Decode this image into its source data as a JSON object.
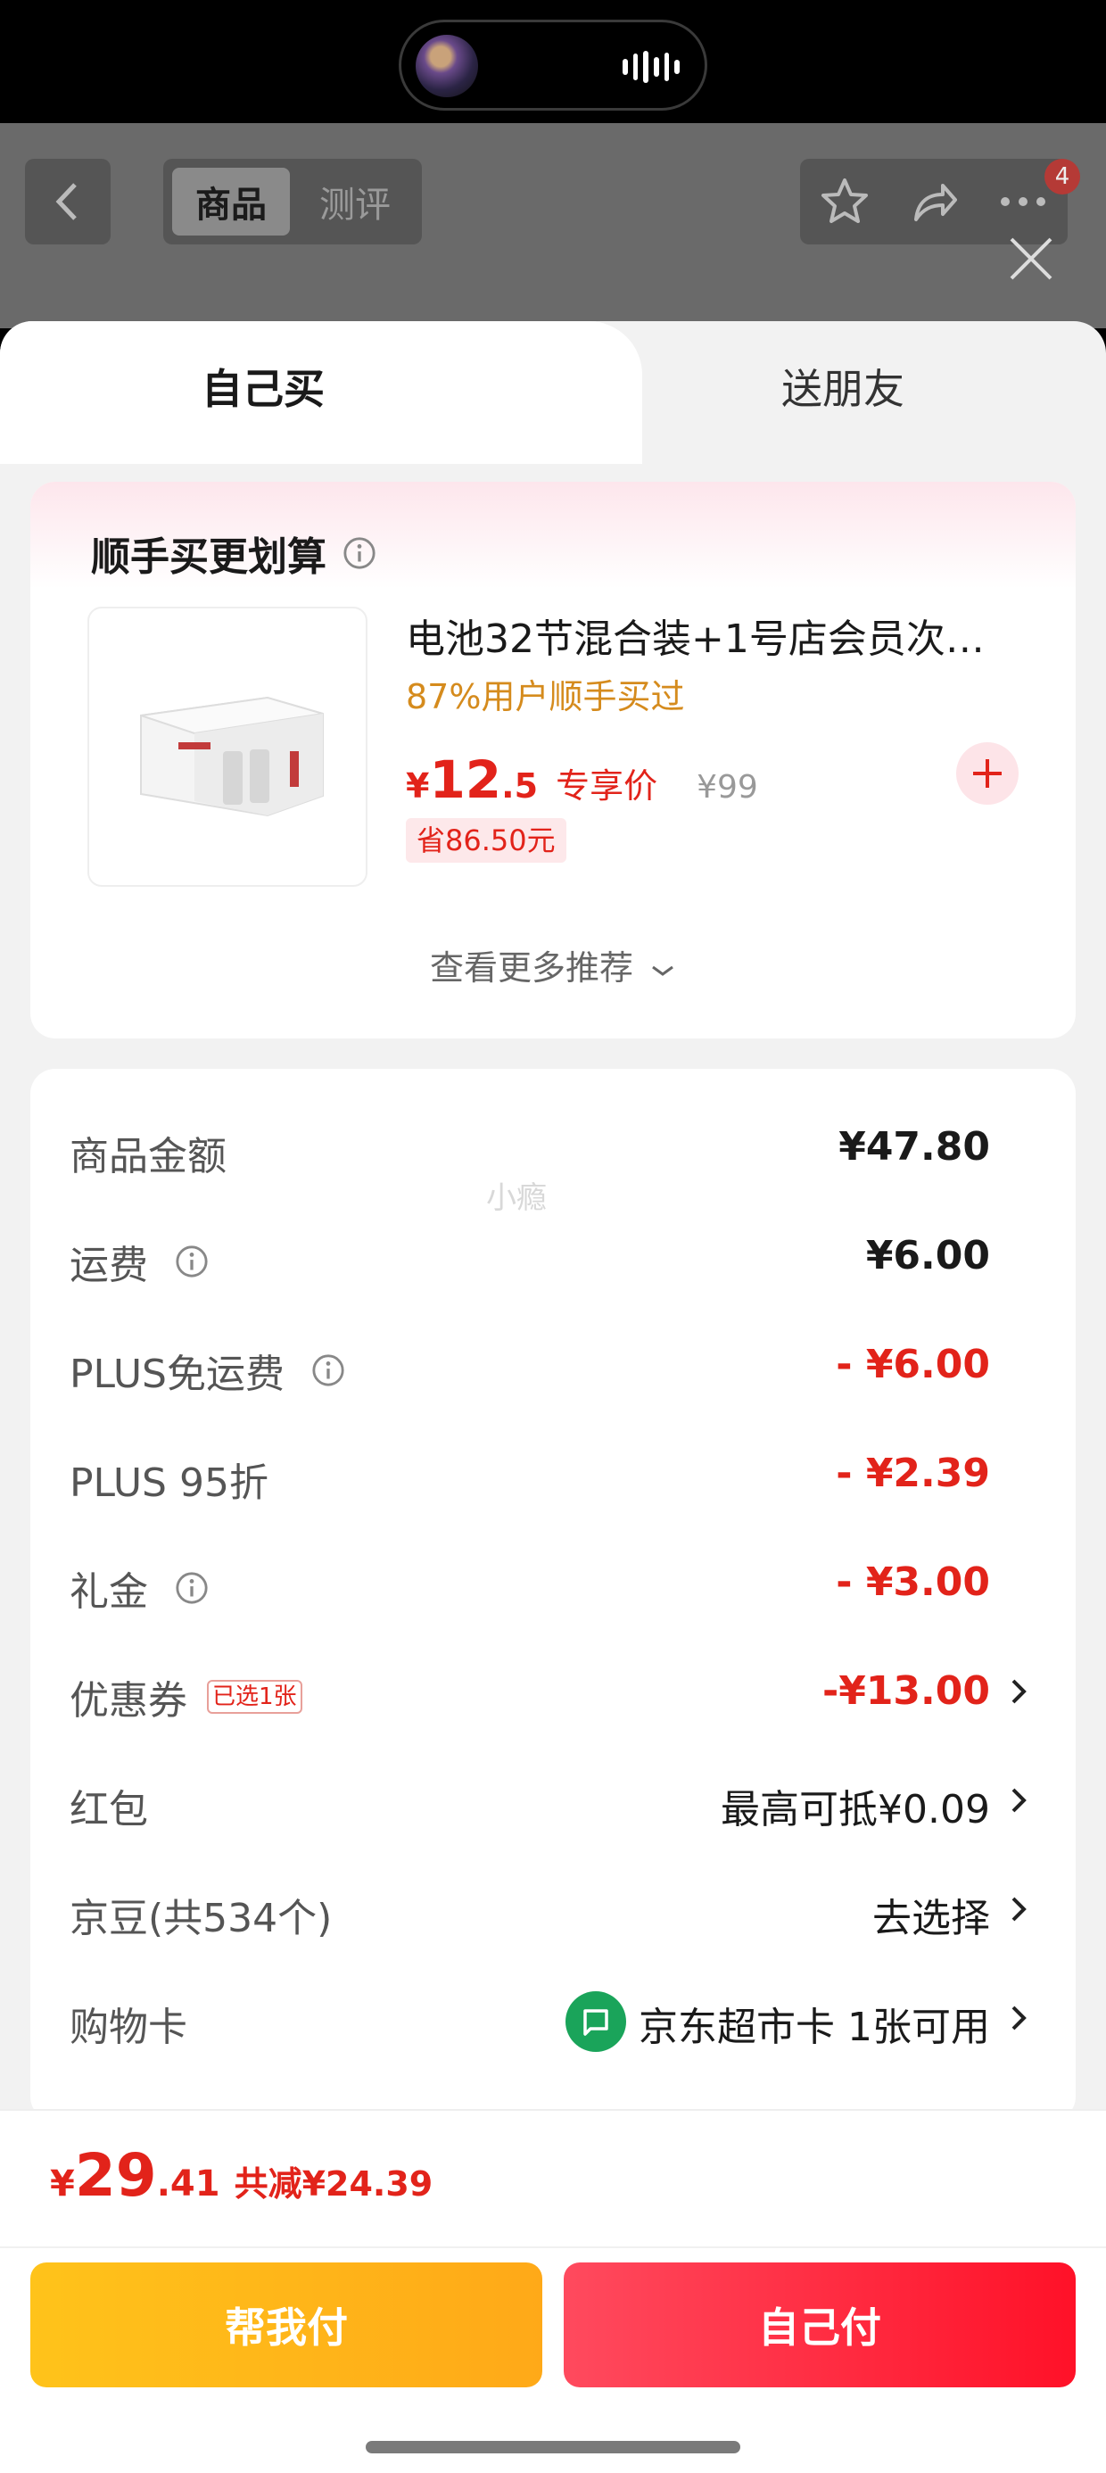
{
  "header": {
    "tab_active": "商品",
    "tab_inactive": "测评",
    "notification_count": "4",
    "icons": [
      "chevron-left-icon",
      "star-icon",
      "share-icon",
      "more-icon",
      "close-icon"
    ]
  },
  "sheet": {
    "tabs": {
      "self": "自己买",
      "friend": "送朋友"
    }
  },
  "recommend": {
    "title": "顺手买更划算",
    "product_title": "电池32节混合装+1号店会员次…",
    "product_sub": "87%用户顺手买过",
    "price_yen": "¥",
    "price_int": "12",
    "price_dec": ".5",
    "price_tag": "专享价",
    "orig_price": "¥99",
    "save_badge": "省86.50元",
    "more": "查看更多推荐"
  },
  "summary": {
    "rows": [
      {
        "label": "商品金额",
        "value": "¥47.80"
      },
      {
        "label": "运费",
        "value": "¥6.00"
      },
      {
        "label": "PLUS免运费",
        "value": "- ¥6.00"
      },
      {
        "label": "PLUS 95折",
        "value": "- ¥2.39"
      },
      {
        "label": "礼金",
        "value": "- ¥3.00"
      },
      {
        "label": "优惠券",
        "tag": "已选1张",
        "value": "-¥13.00"
      },
      {
        "label": "红包",
        "value": "最高可抵¥0.09"
      },
      {
        "label": "京豆(共534个)",
        "value": "去选择"
      },
      {
        "label": "购物卡",
        "value": "京东超市卡 1张可用"
      }
    ],
    "watermark": "小瘾"
  },
  "bottom": {
    "total_yen": "¥",
    "total_int": "29",
    "total_dec": ".41",
    "total_save": "共减¥24.39",
    "btn_help": "帮我付",
    "btn_self": "自己付"
  },
  "colors": {
    "accent_red": "#e2231a",
    "yellow": "#ffb81a",
    "green": "#1aa45a"
  }
}
